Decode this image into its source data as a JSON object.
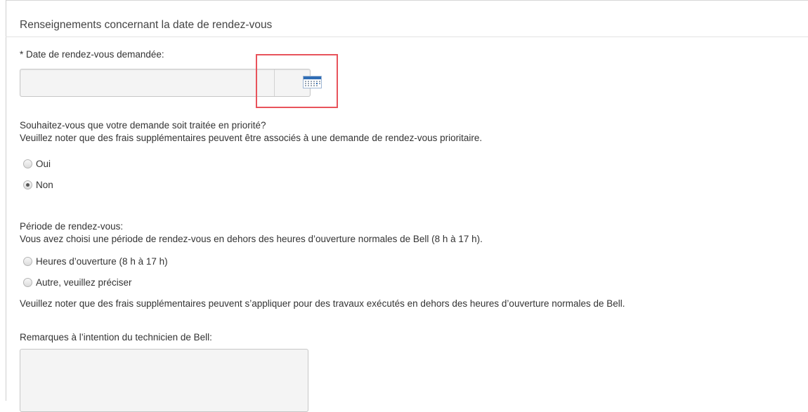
{
  "section": {
    "title": "Renseignements concernant la date de rendez-vous"
  },
  "date_field": {
    "label": "* Date de rendez-vous demandée:",
    "value": "",
    "icon": "calendar-icon"
  },
  "priority": {
    "question": "Souhaitez-vous que votre demande soit traitée en priorité?",
    "note": "Veuillez noter que des frais supplémentaires peuvent être associés à une demande de rendez-vous prioritaire.",
    "options": [
      {
        "label": "Oui",
        "checked": false
      },
      {
        "label": "Non",
        "checked": true
      }
    ]
  },
  "period": {
    "label": "Période de rendez-vous:",
    "note": "Vous avez choisi une période de rendez-vous en dehors des heures d’ouverture normales de Bell (8 h à 17 h).",
    "options": [
      {
        "label": "Heures d’ouverture (8 h à 17 h)",
        "checked": false
      },
      {
        "label": "Autre, veuillez préciser",
        "checked": false
      }
    ],
    "footnote": "Veuillez noter que des frais supplémentaires peuvent s’appliquer pour des travaux exécutés en dehors des heures d’ouverture normales de Bell."
  },
  "remarks": {
    "label": "Remarques à l’intention du technicien de Bell:",
    "value": ""
  },
  "colors": {
    "highlight": "#e8535b",
    "calendar_blue": "#2f6db5"
  }
}
